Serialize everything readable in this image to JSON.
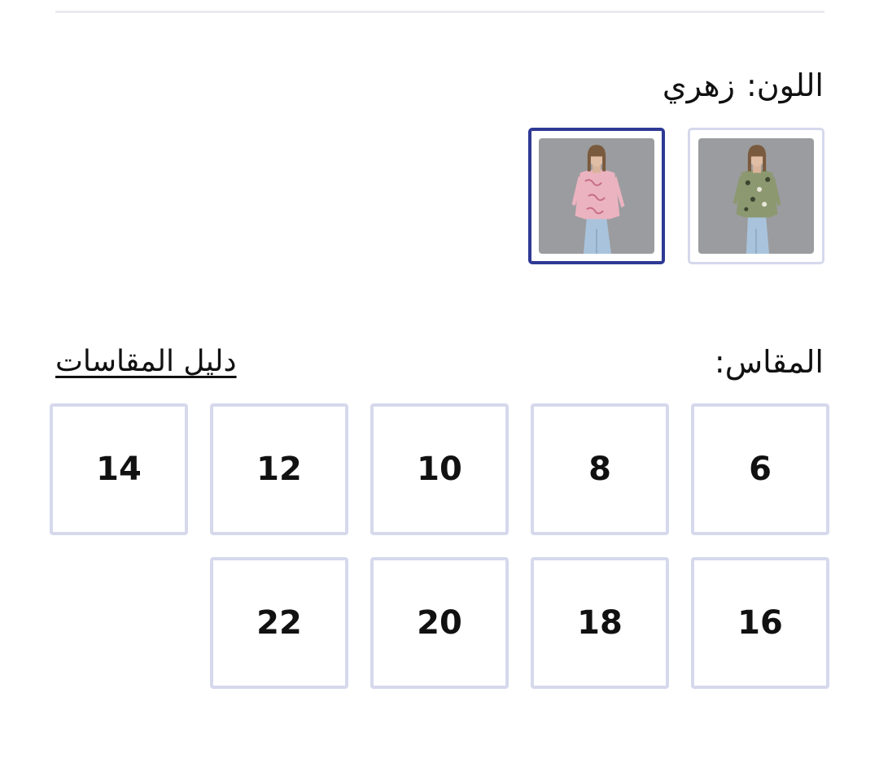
{
  "color": {
    "label": "اللون:",
    "value": "زهري",
    "swatches": [
      {
        "name": "green-print",
        "selected": false,
        "shirt_color": "#8c9870"
      },
      {
        "name": "pink-print",
        "selected": true,
        "shirt_color": "#ebb3c0"
      }
    ]
  },
  "size": {
    "label": "المقاس:",
    "guide_link": "دليل المقاسات",
    "options": [
      "6",
      "8",
      "10",
      "12",
      "14",
      "16",
      "18",
      "20",
      "22"
    ]
  },
  "colors": {
    "selected_border": "#2e3a94",
    "border": "#d6d9ec",
    "divider": "#e9eaee"
  }
}
